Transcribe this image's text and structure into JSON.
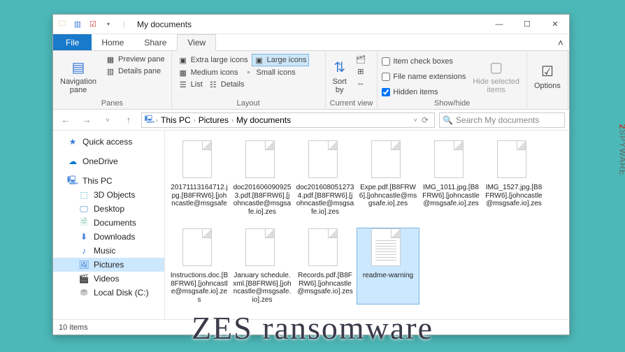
{
  "title": "My documents",
  "tabs": {
    "file": "File",
    "home": "Home",
    "share": "Share",
    "view": "View"
  },
  "ribbon": {
    "panes": {
      "nav": "Navigation\npane",
      "preview": "Preview pane",
      "details": "Details pane",
      "label": "Panes"
    },
    "layout": {
      "xl": "Extra large icons",
      "lg": "Large icons",
      "md": "Medium icons",
      "sm": "Small icons",
      "list": "List",
      "det": "Details",
      "label": "Layout"
    },
    "current": {
      "sort": "Sort\nby",
      "label": "Current view"
    },
    "showhide": {
      "itemcb": "Item check boxes",
      "ext": "File name extensions",
      "hidden": "Hidden items",
      "hide": "Hide selected\nitems",
      "label": "Show/hide"
    },
    "options": "Options"
  },
  "breadcrumb": [
    "This PC",
    "Pictures",
    "My documents"
  ],
  "search_placeholder": "Search My documents",
  "nav": {
    "quick": "Quick access",
    "onedrive": "OneDrive",
    "thispc": "This PC",
    "items": [
      "3D Objects",
      "Desktop",
      "Documents",
      "Downloads",
      "Music",
      "Pictures",
      "Videos",
      "Local Disk (C:)"
    ]
  },
  "files": [
    {
      "name": "20171113164712.jpg.[B8FRW6].[johncastle@msgsafe"
    },
    {
      "name": "doc2016060909253.pdf.[B8FRW6].[johncastle@msgsafe.io].zes"
    },
    {
      "name": "doc2016080512734.pdf.[B8FRW6].[johncastle@msgsafe.io].zes"
    },
    {
      "name": "Expe.pdf.[B8FRW6].[johncastle@msgsafe.io].zes"
    },
    {
      "name": "IMG_1011.jpg.[B8FRW6].[johncastle@msgsafe.io].zes"
    },
    {
      "name": "IMG_1527.jpg.[B8FRW6].[johncastle@msgsafe.io].zes"
    },
    {
      "name": "Instructions.doc.[B8FRW6].[johncastle@msgsafe.io].zes"
    },
    {
      "name": "January schedule.xml.[B8FRW6].[johncastle@msgsafe.io].zes"
    },
    {
      "name": "Records.pdf.[B8FRW6].[johncastle@msgsafe.io].zes"
    },
    {
      "name": "readme-warning",
      "lined": true,
      "selected": true
    }
  ],
  "status": "10 items",
  "watermark": "ZES ransomware",
  "brand": "2SPYWARE"
}
